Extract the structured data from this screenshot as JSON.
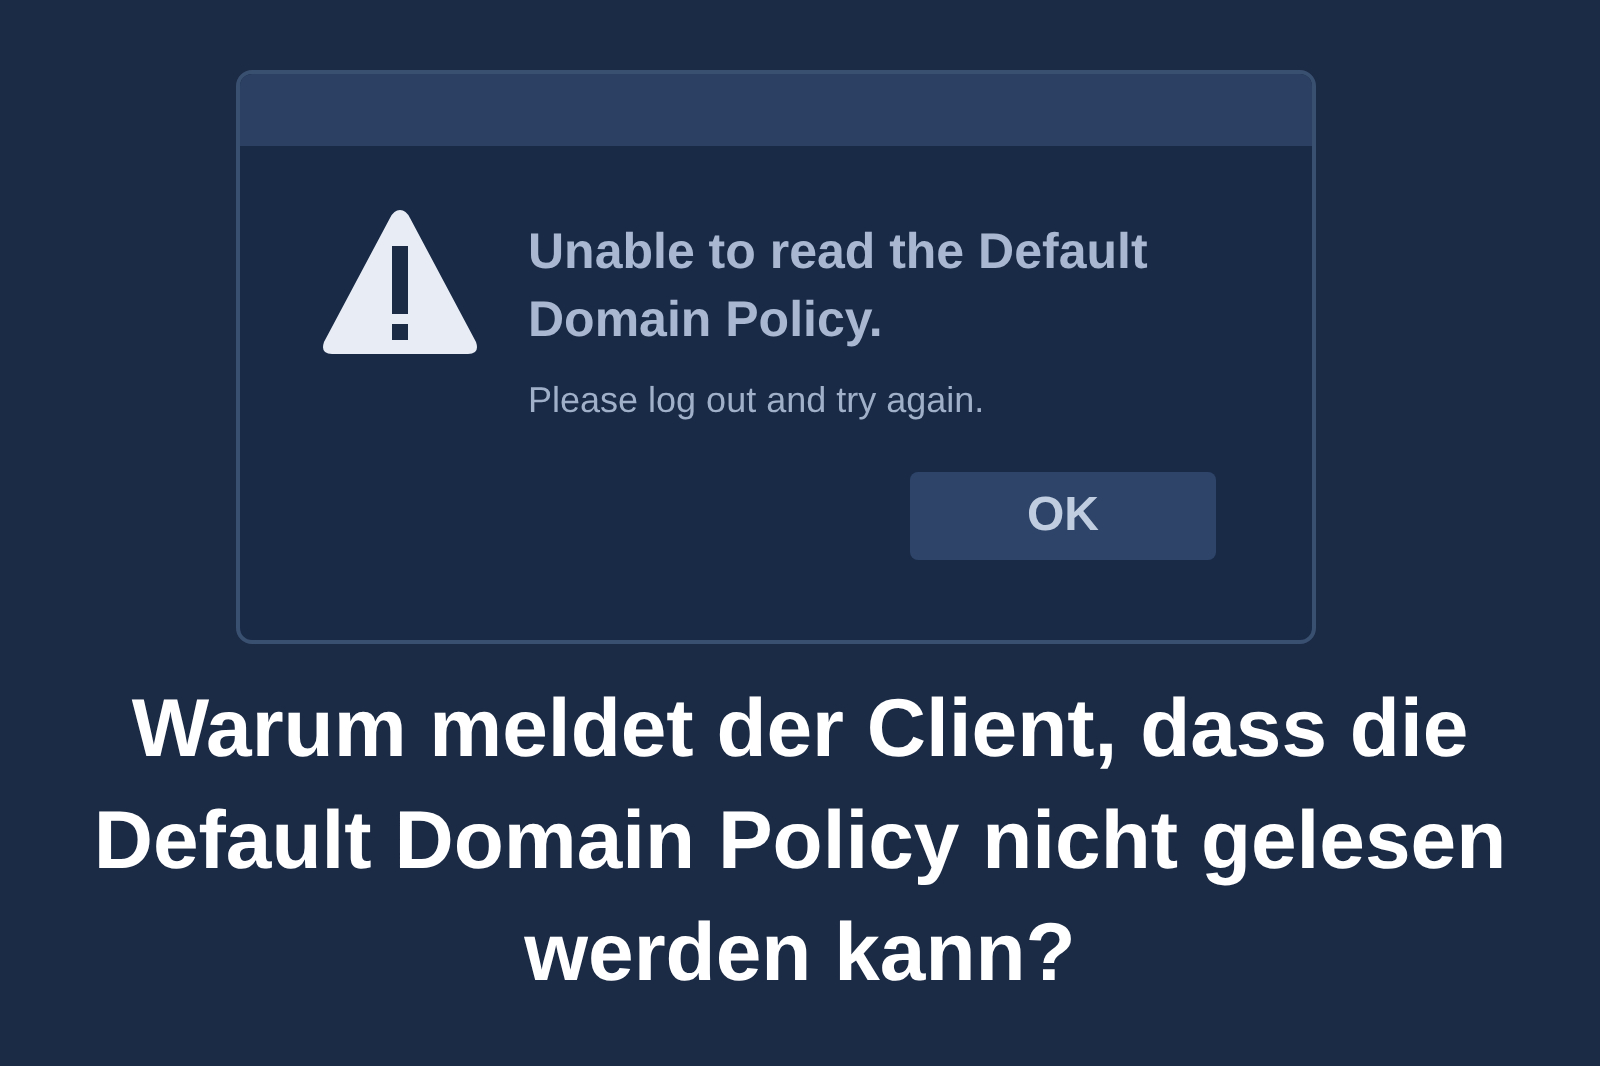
{
  "dialog": {
    "heading": "Unable to read the Default Domain Policy.",
    "message": "Please log out and try again.",
    "buttons": [
      "OK"
    ]
  },
  "caption": "Warum meldet der Client, dass die Default Domain Policy nicht gelesen werden kann?"
}
